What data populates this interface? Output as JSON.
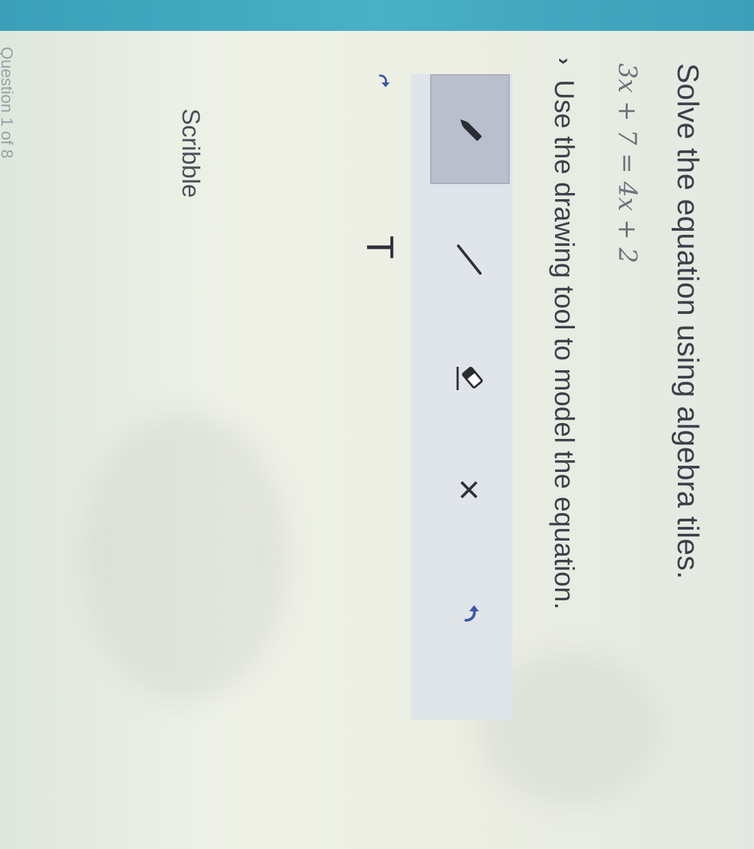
{
  "question": {
    "title": "Solve the equation using algebra tiles.",
    "equation": "3x + 7 = 4x + 2"
  },
  "hint": {
    "chevron": "›",
    "text": "Use the drawing tool to model the equation."
  },
  "toolbar": {
    "tools": [
      {
        "name": "pencil-tool",
        "icon": "pencil-icon",
        "selected": true
      },
      {
        "name": "line-tool",
        "icon": "line-icon"
      },
      {
        "name": "eraser-tool",
        "icon": "eraser-icon"
      },
      {
        "name": "clear-tool",
        "icon": "close-icon",
        "glyph": "×"
      },
      {
        "name": "undo-tool",
        "icon": "undo-arrow-icon"
      }
    ],
    "secondary_tools": [
      {
        "name": "redo-tool",
        "icon": "redo-arrow-icon"
      },
      {
        "name": "text-tool",
        "icon": "text-icon",
        "glyph": "T"
      }
    ]
  },
  "canvas": {
    "label": "Scribble"
  },
  "footer": {
    "pager": "Question 1 of 8"
  },
  "colors": {
    "header_strip": "#49b0c5",
    "toolbar_bg": "#dfe5e9",
    "selected_tool_bg": "#b9bfcc",
    "text": "#3d4049"
  }
}
